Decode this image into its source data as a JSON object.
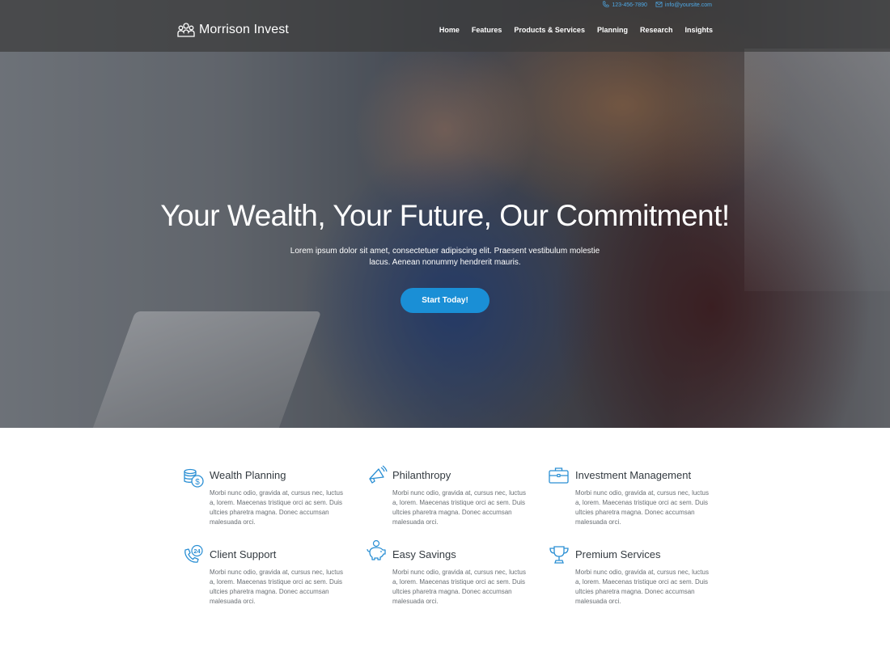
{
  "contact": {
    "phone": "123-456-7890",
    "email": "info@yoursite.com",
    "phone_icon": "phone-icon",
    "email_icon": "envelope-icon"
  },
  "brand": {
    "name": "Morrison Invest",
    "logo_icon": "people-group-logo-icon"
  },
  "nav": {
    "items": [
      {
        "label": "Home"
      },
      {
        "label": "Features"
      },
      {
        "label": "Products & Services"
      },
      {
        "label": "Planning"
      },
      {
        "label": "Research"
      },
      {
        "label": "Insights"
      }
    ]
  },
  "hero": {
    "title": "Your Wealth, Your Future, Our Commitment!",
    "text": "Lorem ipsum dolor sit amet, consectetuer adipiscing elit. Praesent vestibulum molestie lacus. Aenean nonummy hendrerit mauris.",
    "cta_label": "Start Today!"
  },
  "services": {
    "items": [
      {
        "title": "Wealth Planning",
        "icon": "coins-dollar-icon",
        "text": "Morbi nunc odio, gravida at, cursus nec, luctus a, lorem. Maecenas tristique orci ac sem. Duis ultcies pharetra magna. Donec accumsan malesuada orci."
      },
      {
        "title": "Philanthropy",
        "icon": "megaphone-icon",
        "text": "Morbi nunc odio, gravida at, cursus nec, luctus a, lorem. Maecenas tristique orci ac sem. Duis ultcies pharetra magna. Donec accumsan malesuada orci."
      },
      {
        "title": "Investment Management",
        "icon": "briefcase-icon",
        "text": "Morbi nunc odio, gravida at, cursus nec, luctus a, lorem. Maecenas tristique orci ac sem. Duis ultcies pharetra magna. Donec accumsan malesuada orci."
      },
      {
        "title": "Client Support",
        "icon": "phone-24-icon",
        "text": "Morbi nunc odio, gravida at, cursus nec, luctus a, lorem. Maecenas tristique orci ac sem. Duis ultcies pharetra magna. Donec accumsan malesuada orci."
      },
      {
        "title": "Easy Savings",
        "icon": "piggy-bank-icon",
        "text": "Morbi nunc odio, gravida at, cursus nec, luctus a, lorem. Maecenas tristique orci ac sem. Duis ultcies pharetra magna. Donec accumsan malesuada orci."
      },
      {
        "title": "Premium Services",
        "icon": "trophy-icon",
        "text": "Morbi nunc odio, gravida at, cursus nec, luctus a, lorem. Maecenas tristique orci ac sem. Duis ultcies pharetra magna. Donec accumsan malesuada orci."
      }
    ]
  },
  "colors": {
    "accent": "#1a8fd6",
    "icon": "#2a8fd4",
    "heading": "#333a40",
    "body_text": "#6a6f74"
  }
}
